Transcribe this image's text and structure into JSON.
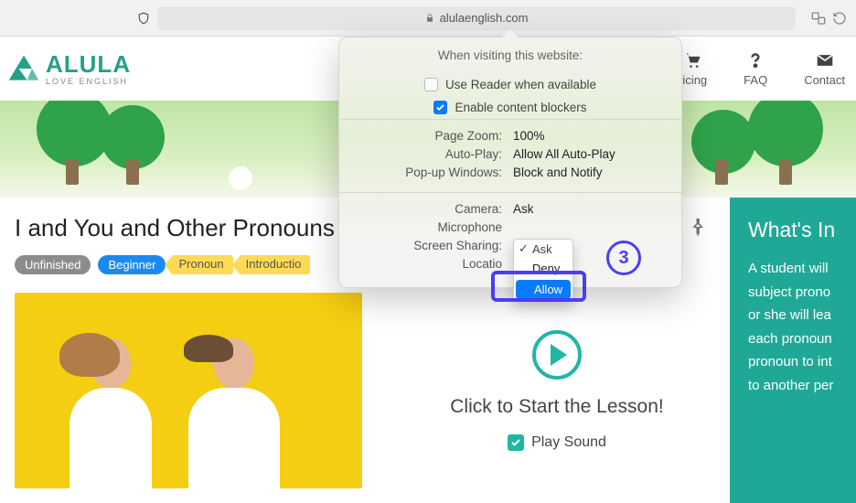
{
  "browser": {
    "domain": "alulaenglish.com"
  },
  "brand": {
    "name": "ALULA",
    "tagline": "LOVE ENGLISH"
  },
  "nav": {
    "pricing": "ricing",
    "faq": "FAQ",
    "contact": "Contact"
  },
  "page": {
    "title": "I and You and Other Pronouns",
    "badges": {
      "status": "Unfinished",
      "level": "Beginner"
    },
    "tags": [
      "Pronoun",
      "Introductio"
    ],
    "start_label": "Click to Start the Lesson!",
    "play_sound_label": "Play Sound"
  },
  "sidebar": {
    "title": "What's In",
    "body": "A student will subject prono or she will lea each pronoun pronoun to int to another per"
  },
  "popover": {
    "header": "When visiting this website:",
    "reader_label": "Use Reader when available",
    "blockers_label": "Enable content blockers",
    "settings": {
      "page_zoom": {
        "label": "Page Zoom:",
        "value": "100%"
      },
      "autoplay": {
        "label": "Auto-Play:",
        "value": "Allow All Auto-Play"
      },
      "popups": {
        "label": "Pop-up Windows:",
        "value": "Block and Notify"
      },
      "camera": {
        "label": "Camera:",
        "value": "Ask"
      },
      "microphone": {
        "label": "Microphone"
      },
      "screenshare": {
        "label": "Screen Sharing:"
      },
      "location": {
        "label": "Locatio"
      }
    },
    "dropdown": {
      "ask": "Ask",
      "deny": "Deny",
      "allow": "Allow"
    },
    "step": "3"
  }
}
